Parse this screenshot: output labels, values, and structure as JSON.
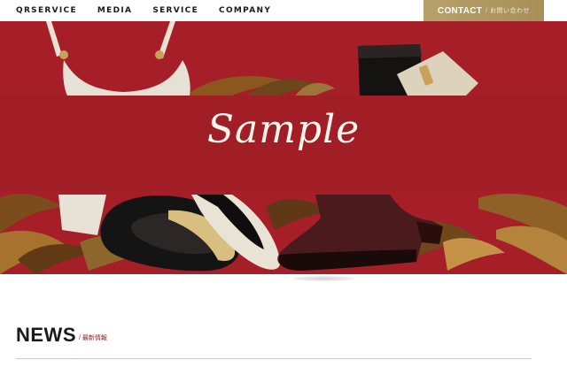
{
  "nav": {
    "items": [
      {
        "label": "QRSERVICE"
      },
      {
        "label": "MEDIA"
      },
      {
        "label": "SERVICE"
      },
      {
        "label": "COMPANY"
      }
    ],
    "contact_label": "CONTACT",
    "contact_sub": "/ お問い合わせ"
  },
  "hero": {
    "title": "Sample",
    "background_color": "#a61f28"
  },
  "news": {
    "title": "NEWS",
    "subtitle": "/ 最新情報"
  },
  "colors": {
    "accent_gold": "#b7a06a",
    "brand_red": "#a61f28"
  }
}
